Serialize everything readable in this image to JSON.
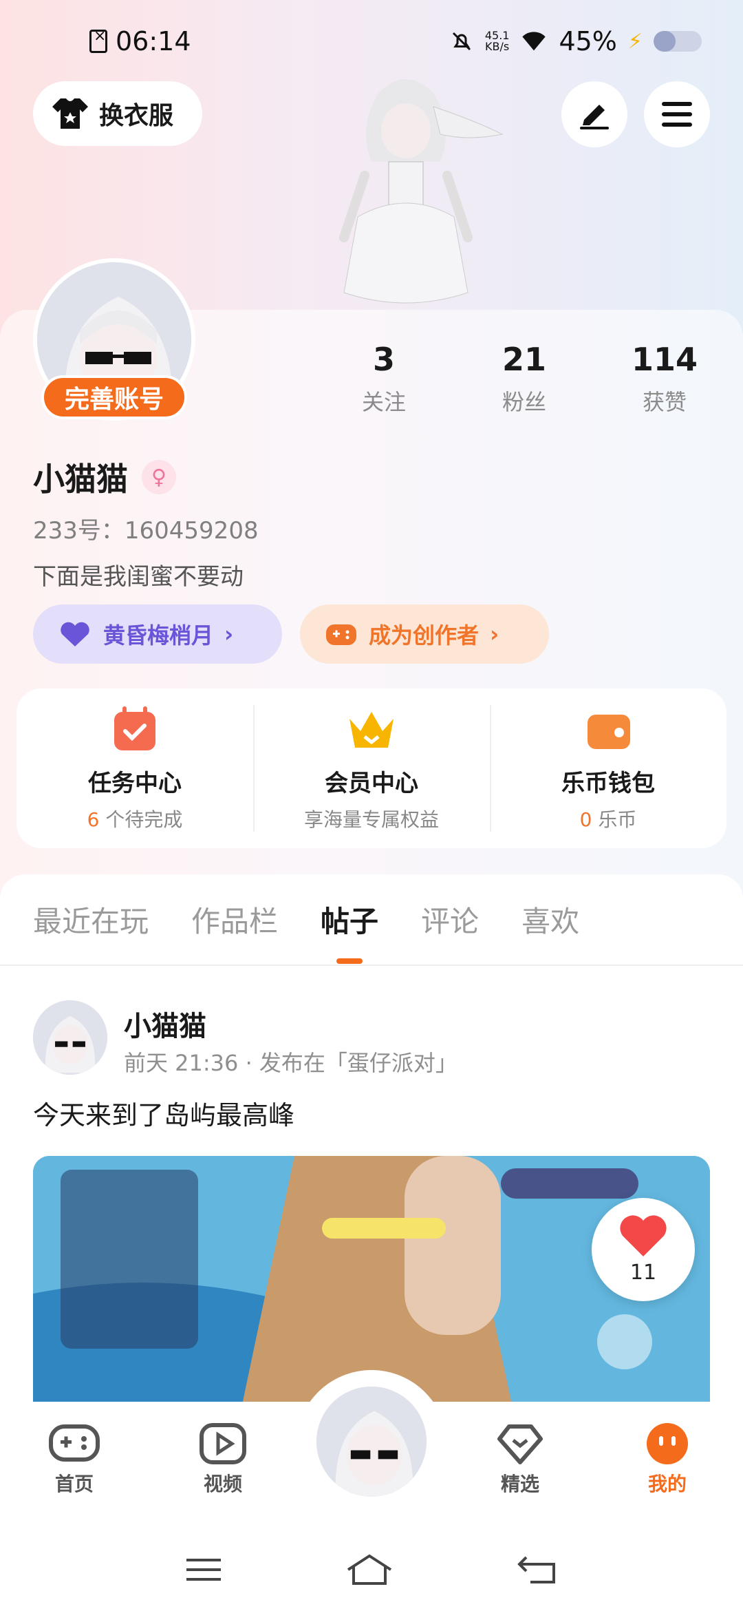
{
  "status_bar": {
    "time": "06:14",
    "net_speed_value": "45.1",
    "net_speed_unit": "KB/s",
    "battery_percent": "45%",
    "battery_level": 0.45
  },
  "header": {
    "outfit_label": "换衣服",
    "edit_icon": "pencil-icon",
    "menu_icon": "menu-icon"
  },
  "profile": {
    "complete_account": "完善账号",
    "stats": [
      {
        "value": "3",
        "label": "关注"
      },
      {
        "value": "21",
        "label": "粉丝"
      },
      {
        "value": "114",
        "label": "获赞"
      }
    ],
    "name": "小猫猫",
    "gender_symbol": "♀",
    "uid": "233号：160459208",
    "bio": "下面是我闺蜜不要动",
    "pill_left": "黄昏梅梢月",
    "pill_right": "成为创作者"
  },
  "center": [
    {
      "title": "任务中心",
      "sub_highlight": "6",
      "sub_text": " 个待完成"
    },
    {
      "title": "会员中心",
      "sub_highlight": "",
      "sub_text": "享海量专属权益"
    },
    {
      "title": "乐币钱包",
      "sub_highlight": "0",
      "sub_text": " 乐币"
    }
  ],
  "tabs": [
    "最近在玩",
    "作品栏",
    "帖子",
    "评论",
    "喜欢"
  ],
  "active_tab": "帖子",
  "post": {
    "author": "小猫猫",
    "meta": "前天 21:36 · 发布在「蛋仔派对」",
    "text": "今天来到了岛屿最高峰",
    "likes": "11"
  },
  "bottom_nav": [
    {
      "label": "首页"
    },
    {
      "label": "视频"
    },
    {
      "label": "精选"
    },
    {
      "label": "我的"
    }
  ],
  "colors": {
    "accent": "#f46b1c",
    "purple": "#6a55d8"
  }
}
